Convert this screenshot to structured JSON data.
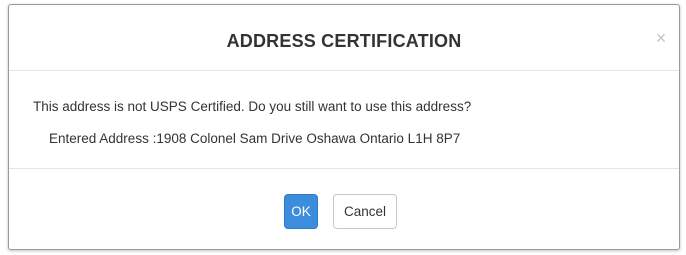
{
  "dialog": {
    "title": "ADDRESS CERTIFICATION",
    "close_glyph": "×",
    "message": "This address is not USPS Certified. Do you still want to use this address?",
    "entered_address": "Entered Address :1908 Colonel Sam Drive Oshawa Ontario L1H 8P7",
    "ok_label": "OK",
    "cancel_label": "Cancel"
  },
  "colors": {
    "primary_button": "#3c8ddc",
    "text": "#333333",
    "divider": "#e5e5e5",
    "close_icon": "#c4c4c4"
  },
  "icons": {
    "close": "close-icon"
  }
}
